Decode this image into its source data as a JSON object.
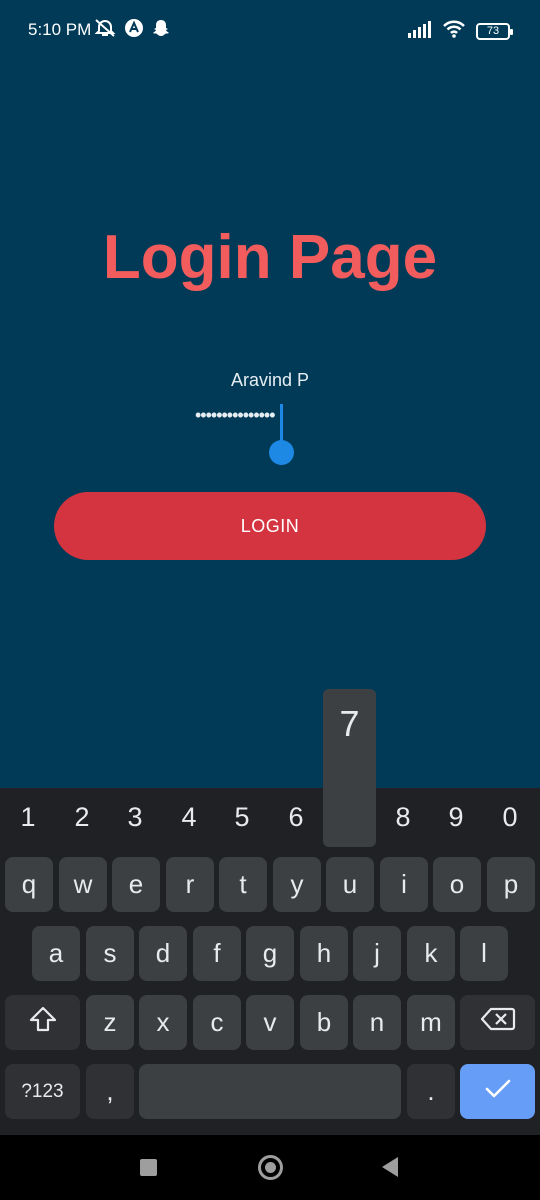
{
  "status_bar": {
    "time": "5:10 PM",
    "left_icons": [
      "alarm-off-icon",
      "app-a-icon",
      "snapchat-icon"
    ],
    "right_icons": [
      "signal-icon",
      "wifi-icon",
      "battery-icon"
    ],
    "battery_level": "73"
  },
  "app": {
    "title": "Login Page",
    "username_value": "Aravind P",
    "password_value": "•••••••••••••••",
    "login_label": "LOGIN"
  },
  "colors": {
    "background": "#003a57",
    "title": "#f25c5c",
    "button": "#d3343f",
    "cursor": "#1e88e5",
    "keyboard": "#202124",
    "key": "#3c4043",
    "action_key": "#669df6"
  },
  "keyboard": {
    "popup_key": "7",
    "number_row": [
      "1",
      "2",
      "3",
      "4",
      "5",
      "6",
      "7",
      "8",
      "9",
      "0"
    ],
    "row1": [
      "q",
      "w",
      "e",
      "r",
      "t",
      "y",
      "u",
      "i",
      "o",
      "p"
    ],
    "row2": [
      "a",
      "s",
      "d",
      "f",
      "g",
      "h",
      "j",
      "k",
      "l"
    ],
    "row3": [
      "z",
      "x",
      "c",
      "v",
      "b",
      "n",
      "m"
    ],
    "symbols_label": "?123",
    "comma_label": ",",
    "period_label": ".",
    "icons": [
      "shift-icon",
      "backspace-icon",
      "checkmark-icon"
    ]
  },
  "nav_bar": {
    "icons": [
      "recents-icon",
      "home-icon",
      "back-icon"
    ]
  }
}
